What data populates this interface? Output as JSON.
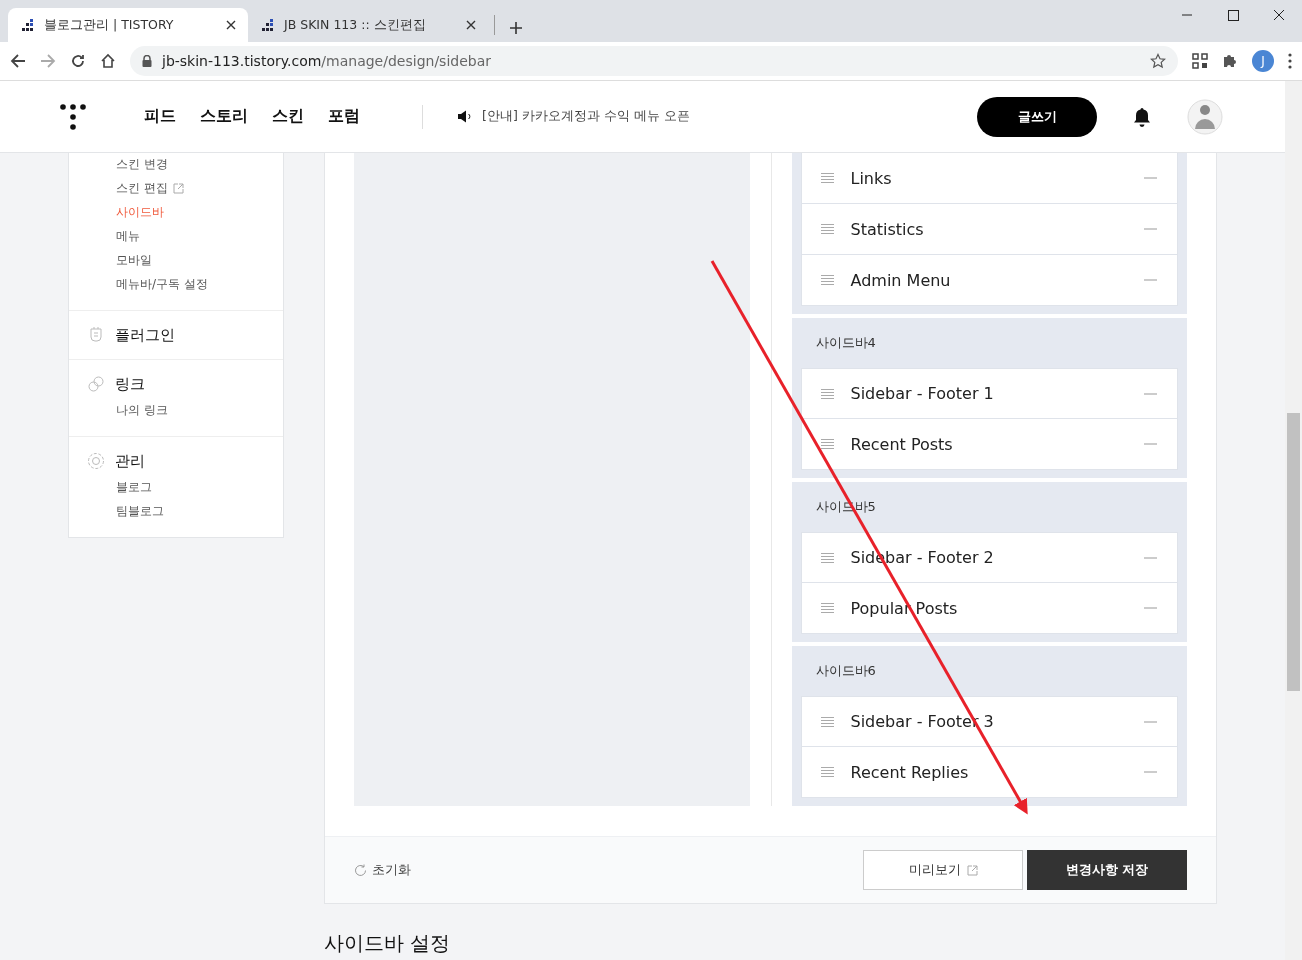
{
  "browser": {
    "tabs": [
      {
        "title": "블로그관리 | TISTORY",
        "selected": true
      },
      {
        "title": "JB SKIN 113 :: 스킨편집",
        "selected": false
      }
    ],
    "url_host": "jb-skin-113.tistory.com",
    "url_path": "/manage/design/sidebar",
    "profile_initial": "J"
  },
  "header": {
    "nav": [
      "피드",
      "스토리",
      "스킨",
      "포럼"
    ],
    "notice": "[안내] 카카오계정과 수익 메뉴 오픈",
    "write_button": "글쓰기"
  },
  "side_nav": {
    "items": [
      {
        "label": "스킨 변경",
        "selected": false
      },
      {
        "label": "스킨 편집",
        "selected": false,
        "external": true
      },
      {
        "label": "사이드바",
        "selected": true
      },
      {
        "label": "메뉴",
        "selected": false
      },
      {
        "label": "모바일",
        "selected": false
      },
      {
        "label": "메뉴바/구독 설정",
        "selected": false
      }
    ],
    "sections": [
      {
        "kind": "plug",
        "title": "플러그인"
      },
      {
        "kind": "link",
        "title": "링크",
        "children": [
          "나의 링크"
        ]
      },
      {
        "kind": "gear",
        "title": "관리",
        "children": [
          "블로그",
          "팀블로그"
        ]
      }
    ]
  },
  "sidebar_groups": [
    {
      "items": [
        "Links",
        "Statistics",
        "Admin Menu"
      ]
    },
    {
      "title": "사이드바4",
      "items": [
        "Sidebar - Footer 1",
        "Recent Posts"
      ]
    },
    {
      "title": "사이드바5",
      "items": [
        "Sidebar - Footer 2",
        "Popular Posts"
      ]
    },
    {
      "title": "사이드바6",
      "items": [
        "Sidebar - Footer 3",
        "Recent Replies"
      ]
    }
  ],
  "footer": {
    "reset": "초기화",
    "preview": "미리보기",
    "save": "변경사항 저장"
  },
  "section_title": "사이드바 설정"
}
